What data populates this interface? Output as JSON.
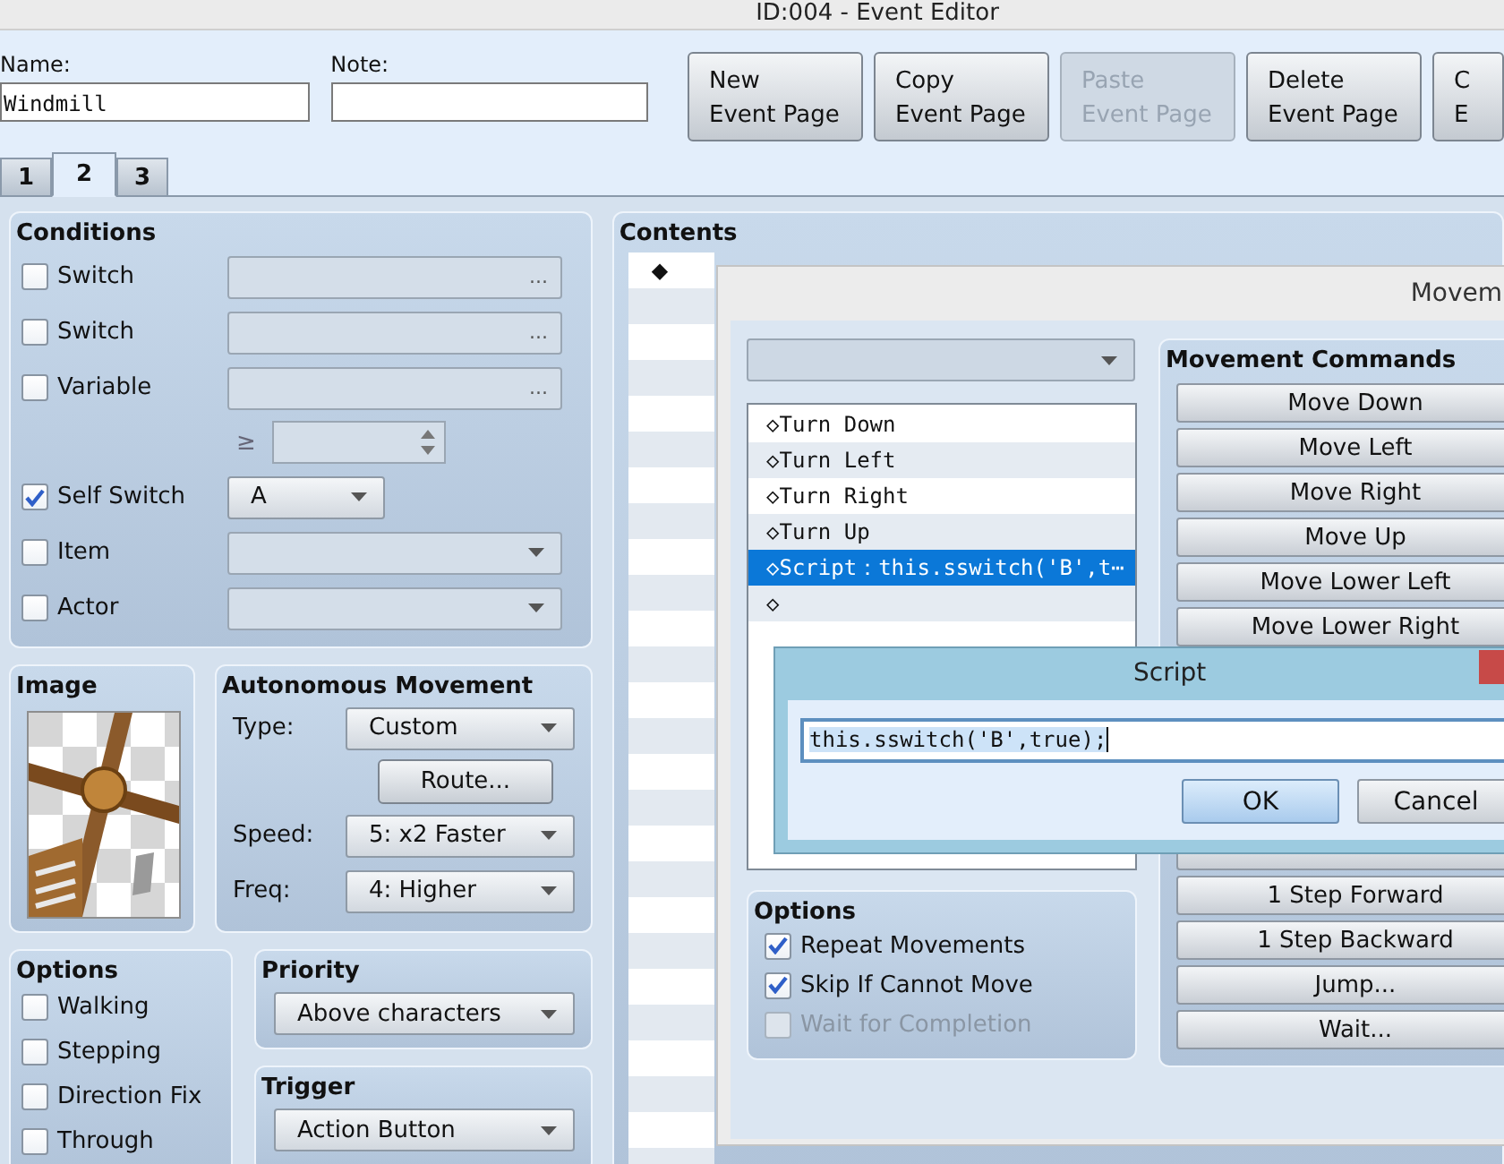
{
  "window": {
    "title": "ID:004 - Event Editor"
  },
  "name": {
    "label": "Name:",
    "value": "Windmill"
  },
  "note": {
    "label": "Note:"
  },
  "page_buttons": [
    {
      "lines": [
        "New",
        "Event Page"
      ],
      "disabled": false
    },
    {
      "lines": [
        "Copy",
        "Event Page"
      ],
      "disabled": false
    },
    {
      "lines": [
        "Paste",
        "Event Page"
      ],
      "disabled": true
    },
    {
      "lines": [
        "Delete",
        "Event Page"
      ],
      "disabled": false
    },
    {
      "lines": [
        "C",
        "E"
      ],
      "disabled": false
    }
  ],
  "tabs": [
    {
      "label": "1",
      "selected": false
    },
    {
      "label": "2",
      "selected": true
    },
    {
      "label": "3",
      "selected": false
    }
  ],
  "conditions": {
    "title": "Conditions",
    "rows": [
      {
        "kind": "picker",
        "label": "Switch",
        "checked": false,
        "button": "..."
      },
      {
        "kind": "picker",
        "label": "Switch",
        "checked": false,
        "button": "..."
      },
      {
        "kind": "picker",
        "label": "Variable",
        "checked": false,
        "button": "..."
      },
      {
        "kind": "compare",
        "symbol": "≥"
      },
      {
        "kind": "dropdown",
        "label": "Self Switch",
        "checked": true,
        "value": "A",
        "disabled": false
      },
      {
        "kind": "dropdown",
        "label": "Item",
        "checked": false,
        "disabled": true
      },
      {
        "kind": "dropdown",
        "label": "Actor",
        "checked": false,
        "disabled": true
      }
    ]
  },
  "image": {
    "title": "Image",
    "kind": "picture"
  },
  "autonomous_movement": {
    "title": "Autonomous Movement",
    "fields": [
      {
        "kind": "dropdown",
        "label": "Type:",
        "value": "Custom"
      },
      {
        "kind": "button",
        "label": "Route..."
      },
      {
        "kind": "dropdown",
        "label": "Speed:",
        "value": "5: x2 Faster"
      },
      {
        "kind": "dropdown",
        "label": "Freq:",
        "value": "4: Higher"
      }
    ]
  },
  "options": {
    "title": "Options",
    "items": [
      {
        "label": "Walking",
        "checked": false
      },
      {
        "label": "Stepping",
        "checked": false
      },
      {
        "label": "Direction Fix",
        "checked": false
      },
      {
        "label": "Through",
        "checked": false
      }
    ]
  },
  "priority": {
    "title": "Priority",
    "value": "Above characters"
  },
  "trigger": {
    "title": "Trigger",
    "value": "Action Button"
  },
  "contents": {
    "title": "Contents",
    "marker": "◆"
  },
  "route_window": {
    "title": "Movem",
    "commands_list": [
      {
        "text": "◇Turn Down",
        "selected": false
      },
      {
        "text": "◇Turn Left",
        "selected": false
      },
      {
        "text": "◇Turn Right",
        "selected": false
      },
      {
        "text": "◇Turn Up",
        "selected": false
      },
      {
        "text": "◇Script：this.sswitch('B',t⋯",
        "selected": true
      },
      {
        "text": "◇",
        "selected": false
      }
    ],
    "options": {
      "title": "Options",
      "items": [
        {
          "label": "Repeat Movements",
          "checked": true,
          "disabled": false
        },
        {
          "label": "Skip If Cannot Move",
          "checked": true,
          "disabled": false
        },
        {
          "label": "Wait for Completion",
          "checked": false,
          "disabled": true
        }
      ]
    },
    "movement_commands": {
      "title": "Movement Commands",
      "buttons_top": [
        "Move Down",
        "Move Left",
        "Move Right",
        "Move Up",
        "Move Lower Left",
        "Move Lower Right"
      ],
      "buttons_bottom": [
        "1 Step Forward",
        "1 Step Backward",
        "Jump...",
        "Wait..."
      ]
    }
  },
  "script_dialog": {
    "title": "Script",
    "value": "this.sswitch('B',true);",
    "buttons": [
      {
        "label": "OK",
        "default": true
      },
      {
        "label": "Cancel",
        "default": false
      }
    ]
  }
}
